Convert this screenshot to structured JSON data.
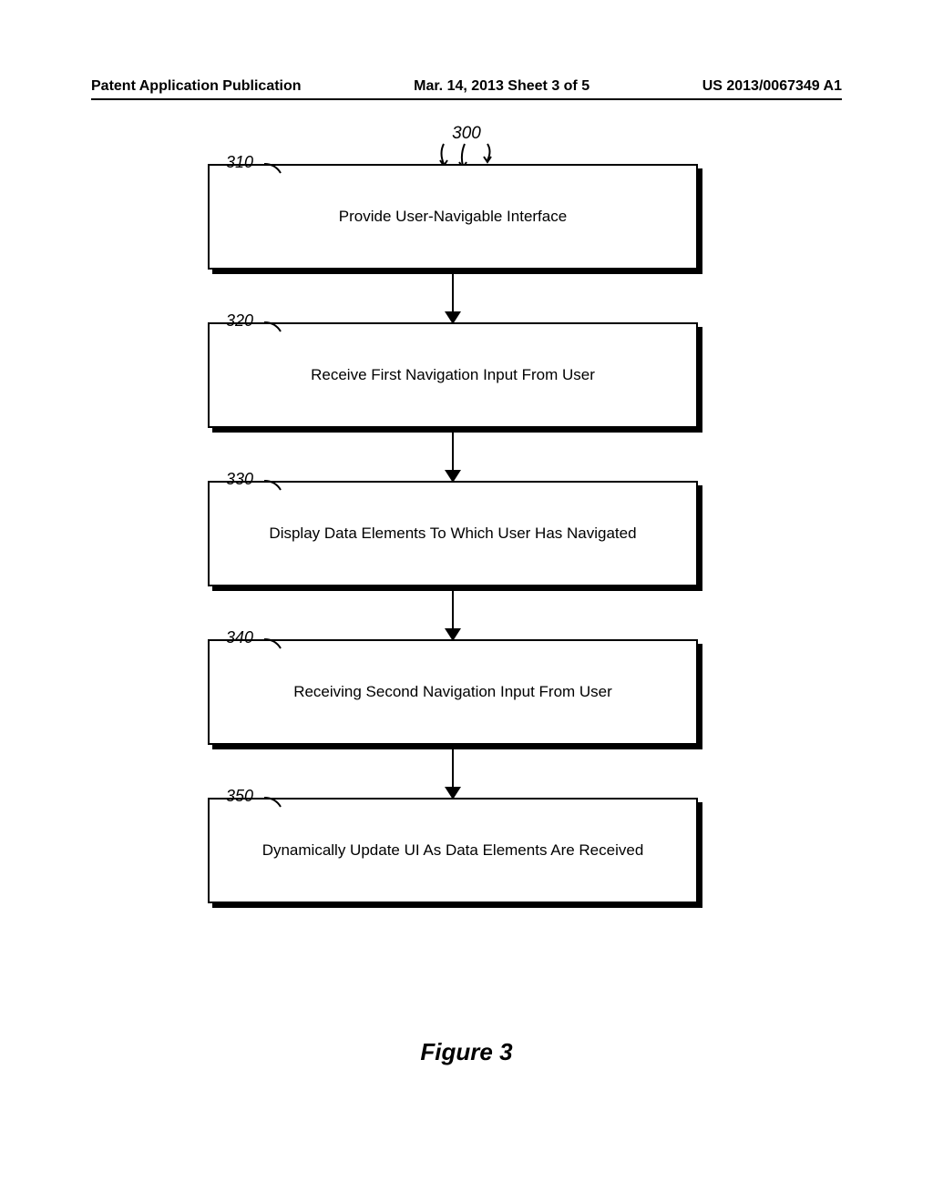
{
  "header": {
    "left": "Patent Application Publication",
    "center": "Mar. 14, 2013  Sheet 3 of 5",
    "right": "US 2013/0067349 A1"
  },
  "figure": {
    "reference": "300",
    "caption": "Figure 3",
    "steps": [
      {
        "label": "310",
        "text": "Provide User-Navigable Interface"
      },
      {
        "label": "320",
        "text": "Receive First Navigation Input From User"
      },
      {
        "label": "330",
        "text": "Display Data Elements To Which User Has Navigated"
      },
      {
        "label": "340",
        "text": "Receiving Second Navigation Input From User"
      },
      {
        "label": "350",
        "text": "Dynamically Update UI As Data Elements Are Received"
      }
    ]
  }
}
